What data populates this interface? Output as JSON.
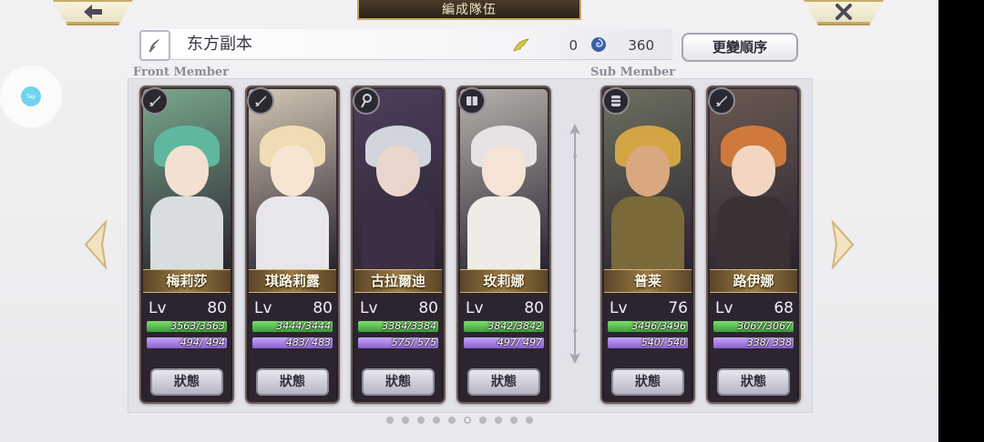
{
  "header": {
    "title": "編成隊伍",
    "back_icon": "back-arrow-icon",
    "close_icon": "close-x-icon"
  },
  "party": {
    "name": "东方副本",
    "wing_value": "0",
    "orb_value": "360",
    "order_button": "更變順序"
  },
  "sections": {
    "front_label": "Front Member",
    "sub_label": "Sub Member"
  },
  "tap_label": "Tap",
  "members": [
    {
      "name": "梅莉莎",
      "lv_label": "Lv",
      "level": "80",
      "hp": "3563/3563",
      "mp": "494/ 494",
      "status": "狀態",
      "class_icon": "sword-icon",
      "hair": "#5fb7a0",
      "skin": "#f4e0d2",
      "outfit": "#d8dde0",
      "bg": "#79a88c"
    },
    {
      "name": "琪路莉露",
      "lv_label": "Lv",
      "level": "80",
      "hp": "3444/3444",
      "mp": "483/ 483",
      "status": "狀態",
      "class_icon": "sword-icon",
      "hair": "#efdcb4",
      "skin": "#f7e5d4",
      "outfit": "#e8e6ea",
      "bg": "#d4c7b4"
    },
    {
      "name": "古拉爾迪",
      "lv_label": "Lv",
      "level": "80",
      "hp": "3384/3384",
      "mp": "575/ 575",
      "status": "狀態",
      "class_icon": "magic-staff-icon",
      "hair": "#d2d5de",
      "skin": "#ead6cc",
      "outfit": "#3c2e44",
      "bg": "#4d3f5c"
    },
    {
      "name": "玫莉娜",
      "lv_label": "Lv",
      "level": "80",
      "hp": "3842/3842",
      "mp": "497/ 497",
      "status": "狀態",
      "class_icon": "book-icon",
      "hair": "#e6e3e2",
      "skin": "#f5e3d6",
      "outfit": "#efece8",
      "bg": "#b7b1ad"
    },
    {
      "name": "普莱",
      "lv_label": "Lv",
      "level": "76",
      "hp": "3496/3496",
      "mp": "540/ 540",
      "status": "狀態",
      "class_icon": "gauntlet-icon",
      "hair": "#d3a444",
      "skin": "#d9a880",
      "outfit": "#7a6a3a",
      "bg": "#6d7060"
    },
    {
      "name": "路伊娜",
      "lv_label": "Lv",
      "level": "68",
      "hp": "3067/3067",
      "mp": "338/ 338",
      "status": "狀態",
      "class_icon": "sword-icon",
      "hair": "#cf7a3c",
      "skin": "#f3d6c2",
      "outfit": "#3a3136",
      "bg": "#6b5a52"
    }
  ],
  "page_dots": {
    "count": 10,
    "active": 5
  },
  "icons": {
    "left_nav": "chevron-left-icon",
    "right_nav": "chevron-right-icon",
    "edit": "quill-icon",
    "wing": "wing-icon",
    "orb": "swirl-orb-icon"
  }
}
